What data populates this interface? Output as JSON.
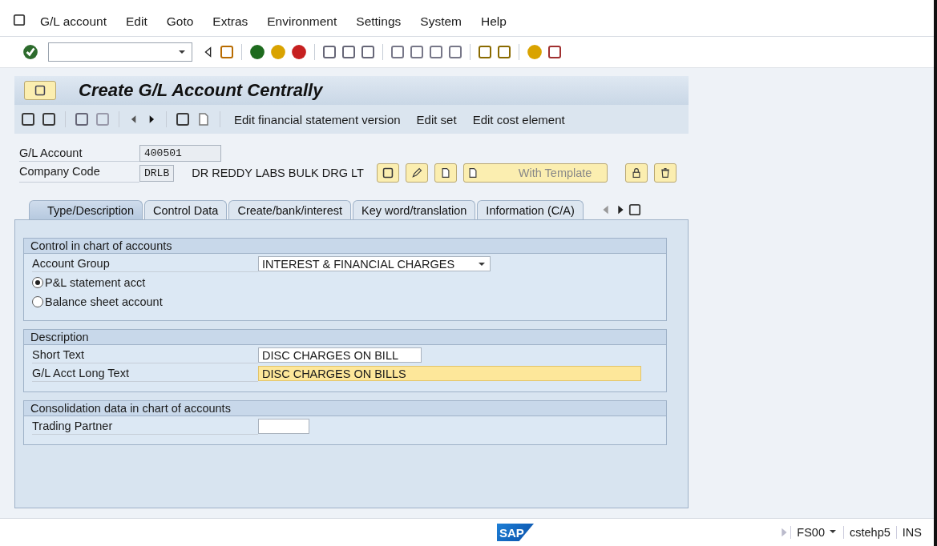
{
  "menu_bar": [
    "G/L account",
    "Edit",
    "Goto",
    "Extras",
    "Environment",
    "Settings",
    "System",
    "Help"
  ],
  "title": "Create G/L Account Centrally",
  "app_toolbar": [
    "Edit financial statement version",
    "Edit set",
    "Edit cost element"
  ],
  "header": {
    "account_label": "G/L Account",
    "account_value": "400501",
    "company_label": "Company Code",
    "company_value": "DRLB",
    "company_name": "DR REDDY LABS BULK DRG LT",
    "template_button": {
      "label": "With Template",
      "disabled": true
    }
  },
  "tabs": [
    {
      "label": "Type/Description",
      "selected": true
    },
    {
      "label": "Control Data",
      "selected": false
    },
    {
      "label": "Create/bank/interest",
      "selected": false
    },
    {
      "label": "Key word/translation",
      "selected": false
    },
    {
      "label": "Information (C/A)",
      "selected": false
    }
  ],
  "groups": [
    {
      "title": "Control in chart of accounts",
      "rows": [
        {
          "kind": "dropdown",
          "label": "Account Group",
          "value": "INTEREST & FINANCIAL CHARGES"
        },
        {
          "kind": "radio",
          "label": "P&L statement acct",
          "selected": true
        },
        {
          "kind": "radio",
          "label": "Balance sheet account",
          "selected": false
        }
      ]
    },
    {
      "title": "Description",
      "rows": [
        {
          "kind": "input",
          "label": "Short Text",
          "value": "DISC CHARGES ON BILL",
          "focused": false
        },
        {
          "kind": "input",
          "label": "G/L Acct Long Text",
          "value": "DISC CHARGES ON BILLS",
          "focused": true
        }
      ]
    },
    {
      "title": "Consolidation data in chart of accounts",
      "rows": [
        {
          "kind": "input",
          "label": "Trading Partner",
          "focused": false
        }
      ]
    }
  ],
  "status_bar": {
    "logo": "SAP",
    "transaction": "FS00",
    "server": "cstehp5",
    "mode": "INS"
  }
}
